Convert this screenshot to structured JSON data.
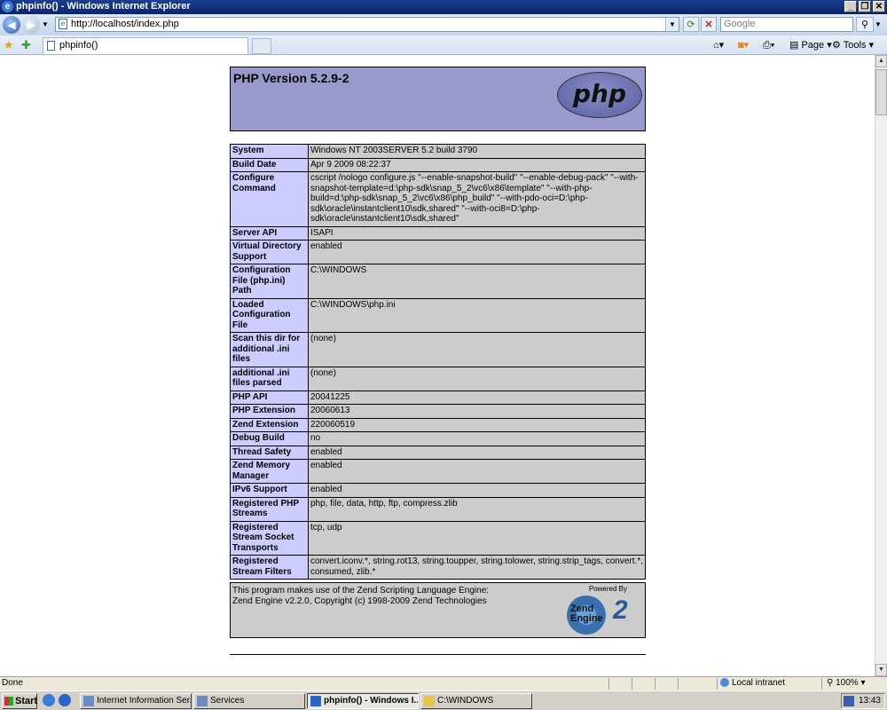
{
  "window": {
    "title": "phpinfo() - Windows Internet Explorer"
  },
  "toolbar": {
    "address": "http://localhost/index.php",
    "search_placeholder": "Google",
    "tab_title": "phpinfo()",
    "page_label": "Page",
    "tools_label": "Tools"
  },
  "php": {
    "version_title": "PHP Version 5.2.9-2",
    "logo_text": "php",
    "rows": [
      {
        "label": "System",
        "value": "Windows NT 2003SERVER 5.2 build 3790"
      },
      {
        "label": "Build Date",
        "value": "Apr 9 2009 08:22:37"
      },
      {
        "label": "Configure Command",
        "value": "cscript /nologo configure.js \"--enable-snapshot-build\" \"--enable-debug-pack\" \"--with-snapshot-template=d:\\php-sdk\\snap_5_2\\vc6\\x86\\template\" \"--with-php-build=d:\\php-sdk\\snap_5_2\\vc6\\x86\\php_build\" \"--with-pdo-oci=D:\\php-sdk\\oracle\\instantclient10\\sdk,shared\" \"--with-oci8=D:\\php-sdk\\oracle\\instantclient10\\sdk,shared\""
      },
      {
        "label": "Server API",
        "value": "ISAPI"
      },
      {
        "label": "Virtual Directory Support",
        "value": "enabled"
      },
      {
        "label": "Configuration File (php.ini) Path",
        "value": "C:\\WINDOWS"
      },
      {
        "label": "Loaded Configuration File",
        "value": "C:\\WINDOWS\\php.ini"
      },
      {
        "label": "Scan this dir for additional .ini files",
        "value": "(none)"
      },
      {
        "label": "additional .ini files parsed",
        "value": "(none)"
      },
      {
        "label": "PHP API",
        "value": "20041225"
      },
      {
        "label": "PHP Extension",
        "value": "20060613"
      },
      {
        "label": "Zend Extension",
        "value": "220060519"
      },
      {
        "label": "Debug Build",
        "value": "no"
      },
      {
        "label": "Thread Safety",
        "value": "enabled"
      },
      {
        "label": "Zend Memory Manager",
        "value": "enabled"
      },
      {
        "label": "IPv6 Support",
        "value": "enabled"
      },
      {
        "label": "Registered PHP Streams",
        "value": "php, file, data, http, ftp, compress.zlib"
      },
      {
        "label": "Registered Stream Socket Transports",
        "value": "tcp, udp"
      },
      {
        "label": "Registered Stream Filters",
        "value": "convert.iconv.*, string.rot13, string.toupper, string.tolower, string.strip_tags, convert.*, consumed, zlib.*"
      }
    ],
    "footer_line1": "This program makes use of the Zend Scripting Language Engine:",
    "footer_line2": "Zend Engine v2.2.0, Copyright (c) 1998-2009 Zend Technologies",
    "powered_by": "Powered By",
    "zend_logo_line1": "Zend",
    "zend_logo_line2": "Engine",
    "zend_logo_num": "2"
  },
  "status": {
    "text": "Done",
    "zone": "Local intranet",
    "zoom": "100%"
  },
  "taskbar": {
    "start": "Start",
    "tasks": [
      "Internet Information Ser...",
      "Services",
      "phpinfo() - Windows I...",
      "C:\\WINDOWS"
    ],
    "clock": "13:43"
  }
}
